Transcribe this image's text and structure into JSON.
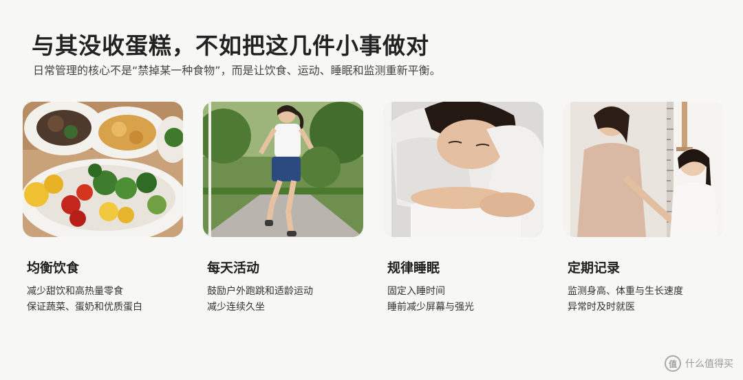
{
  "header": {
    "title": "与其没收蛋糕，不如把这几件小事做对",
    "subtitle": "日常管理的核心不是“禁掉某一种食物”，而是让饮食、运动、睡眠和监测重新平衡。"
  },
  "cards": [
    {
      "title": "均衡饮食",
      "lines": [
        "减少甜饮和高热量零食",
        "保证蔬菜、蛋奶和优质蛋白"
      ],
      "image": "food-plates-photo"
    },
    {
      "title": "每天活动",
      "lines": [
        "鼓励户外跑跳和适龄运动",
        "减少连续久坐"
      ],
      "image": "girl-running-photo"
    },
    {
      "title": "规律睡眠",
      "lines": [
        "固定入睡时间",
        "睡前减少屏幕与强光"
      ],
      "image": "girl-sleeping-photo"
    },
    {
      "title": "定期记录",
      "lines": [
        "监测身高、体重与生长速度",
        "异常时及时就医"
      ],
      "image": "height-measure-photo"
    }
  ],
  "watermark": {
    "logo": "值",
    "text": "什么值得买"
  },
  "colors": {
    "background": "#f7f7f5",
    "text": "#222222"
  }
}
